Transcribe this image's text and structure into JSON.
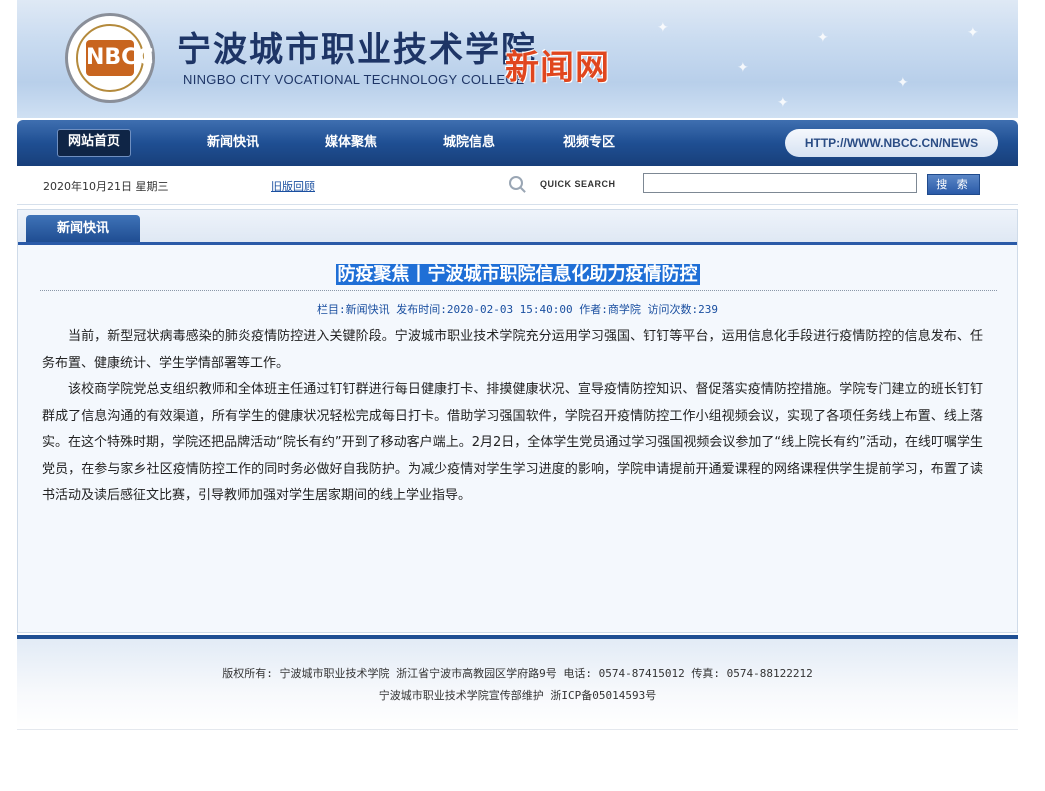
{
  "header": {
    "logo_text": "NBCC",
    "title_cn": "宁波城市职业技术学院",
    "title_en": "NINGBO CITY VOCATIONAL TECHNOLOGY COLLEGE",
    "title_news": "新闻网"
  },
  "nav": {
    "items": [
      {
        "label": "网站首页",
        "active": true
      },
      {
        "label": "新闻快讯"
      },
      {
        "label": "媒体聚焦"
      },
      {
        "label": "城院信息"
      },
      {
        "label": "视频专区"
      }
    ],
    "url": "HTTP://WWW.NBCC.CN/NEWS"
  },
  "infobar": {
    "date": "2020年10月21日  星期三",
    "old_version": "旧版回顾",
    "quick_search": "QUICK SEARCH",
    "search_value": "",
    "search_button": "搜 索"
  },
  "panel": {
    "tab": "新闻快讯"
  },
  "article": {
    "title": "防疫聚焦丨宁波城市职院信息化助力疫情防控",
    "meta": "栏目:新闻快讯  发布时间:2020-02-03 15:40:00   作者:商学院  访问次数:239",
    "paragraphs": [
      "当前，新型冠状病毒感染的肺炎疫情防控进入关键阶段。宁波城市职业技术学院充分运用学习强国、钉钉等平台，运用信息化手段进行疫情防控的信息发布、任务布置、健康统计、学生学情部署等工作。",
      "该校商学院党总支组织教师和全体班主任通过钉钉群进行每日健康打卡、排摸健康状况、宣导疫情防控知识、督促落实疫情防控措施。学院专门建立的班长钉钉群成了信息沟通的有效渠道，所有学生的健康状况轻松完成每日打卡。借助学习强国软件，学院召开疫情防控工作小组视频会议，实现了各项任务线上布置、线上落实。在这个特殊时期，学院还把品牌活动“院长有约”开到了移动客户端上。2月2日，全体学生党员通过学习强国视频会议参加了“线上院长有约”活动，在线叮嘱学生党员，在参与家乡社区疫情防控工作的同时务必做好自我防护。为减少疫情对学生学习进度的影响，学院申请提前开通爱课程的网络课程供学生提前学习，布置了读书活动及读后感征文比赛，引导教师加强对学生居家期间的线上学业指导。"
    ]
  },
  "footer": {
    "line1": "版权所有: 宁波城市职业技术学院 浙江省宁波市高教园区学府路9号 电话: 0574-87415012 传真: 0574-88122212",
    "line2": "宁波城市职业技术学院宣传部维护 浙ICP备05014593号"
  }
}
